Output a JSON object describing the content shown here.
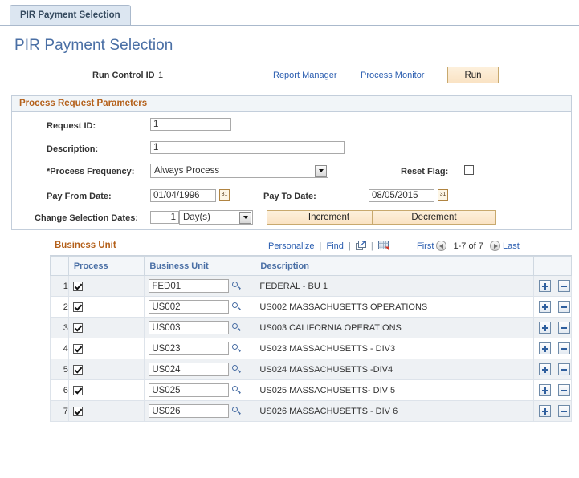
{
  "tab": {
    "label": "PIR Payment Selection"
  },
  "page": {
    "title": "PIR Payment Selection"
  },
  "runcontrol": {
    "label": "Run Control ID",
    "value": "1",
    "report_manager_link": "Report Manager",
    "process_monitor_link": "Process Monitor",
    "run_button": "Run"
  },
  "process_request": {
    "group_title": "Process Request Parameters",
    "request_id_label": "Request ID:",
    "request_id_value": "1",
    "description_label": "Description:",
    "description_value": "1",
    "process_frequency_label": "*Process Frequency:",
    "process_frequency_value": "Always Process",
    "reset_flag_label": "Reset Flag:",
    "reset_flag_checked": false,
    "pay_from_date_label": "Pay From Date:",
    "pay_from_date_value": "01/04/1996",
    "pay_to_date_label": "Pay To Date:",
    "pay_to_date_value": "08/05/2015",
    "calendar_icon_text": "31",
    "change_selection_dates_label": "Change Selection Dates:",
    "change_selection_number": "1",
    "change_selection_unit": "Day(s)",
    "increment_button": "Increment",
    "decrement_button": "Decrement"
  },
  "grid": {
    "title": "Business Unit",
    "personalize_link": "Personalize",
    "find_link": "Find",
    "separator": "|",
    "first_link": "First",
    "last_link": "Last",
    "range_text": "1-7 of 7",
    "columns": {
      "process": "Process",
      "business_unit": "Business Unit",
      "description": "Description"
    },
    "rows": [
      {
        "num": "1",
        "checked": true,
        "unit": "FED01",
        "description": "FEDERAL - BU 1"
      },
      {
        "num": "2",
        "checked": true,
        "unit": "US002",
        "description": "US002 MASSACHUSETTS OPERATIONS"
      },
      {
        "num": "3",
        "checked": true,
        "unit": "US003",
        "description": "US003 CALIFORNIA OPERATIONS"
      },
      {
        "num": "4",
        "checked": true,
        "unit": "US023",
        "description": "US023 MASSACHUSETTS - DIV3"
      },
      {
        "num": "5",
        "checked": true,
        "unit": "US024",
        "description": "US024 MASSACHUSETTS -DIV4"
      },
      {
        "num": "6",
        "checked": true,
        "unit": "US025",
        "description": "US025 MASSACHUSETTS- DIV 5"
      },
      {
        "num": "7",
        "checked": true,
        "unit": "US026",
        "description": "US026 MASSACHUSETTS - DIV 6"
      }
    ]
  },
  "colors": {
    "accent_orange": "#b4601a",
    "link_blue": "#2a5db0",
    "title_blue": "#4a6fa5",
    "button_tan": "#fae3c4"
  }
}
